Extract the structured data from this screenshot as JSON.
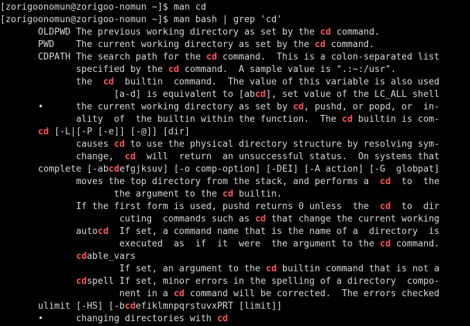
{
  "colors": {
    "background": "#000000",
    "foreground": "#d8d8d8",
    "match_highlight": "#ff5555"
  },
  "lines": [
    [
      {
        "t": "[zorigoonomun@zorigoo-nomun ~]$ man cd",
        "h": false
      }
    ],
    [
      {
        "t": "[zorigoonomun@zorigoo-nomun ~]$ man bash | grep 'cd'",
        "h": false
      }
    ],
    [
      {
        "t": "       OLDPWD The previous working directory as set by the ",
        "h": false
      },
      {
        "t": "cd",
        "h": true
      },
      {
        "t": " command.",
        "h": false
      }
    ],
    [
      {
        "t": "       PWD    The current working directory as set by the ",
        "h": false
      },
      {
        "t": "cd",
        "h": true
      },
      {
        "t": " command.",
        "h": false
      }
    ],
    [
      {
        "t": "       CDPATH The search path for the ",
        "h": false
      },
      {
        "t": "cd",
        "h": true
      },
      {
        "t": " command.  This is a colon-separated list",
        "h": false
      }
    ],
    [
      {
        "t": "              specified by the ",
        "h": false
      },
      {
        "t": "cd",
        "h": true
      },
      {
        "t": " command.  A sample value is \".:~:/usr\".",
        "h": false
      }
    ],
    [
      {
        "t": "              the  ",
        "h": false
      },
      {
        "t": "cd",
        "h": true
      },
      {
        "t": "  builtin  command.  The value of this variable is also used",
        "h": false
      }
    ],
    [
      {
        "t": "                     [a-d] is equivalent to [ab",
        "h": false
      },
      {
        "t": "cd",
        "h": true
      },
      {
        "t": "], set value of the LC_ALL shell",
        "h": false
      }
    ],
    [
      {
        "t": "       •      the current working directory as set by ",
        "h": false
      },
      {
        "t": "cd",
        "h": true
      },
      {
        "t": ", pushd, or popd, or  in-",
        "h": false
      }
    ],
    [
      {
        "t": "              ality  of  the builtin within the function.  The ",
        "h": false
      },
      {
        "t": "cd",
        "h": true
      },
      {
        "t": " builtin is com-",
        "h": false
      }
    ],
    [
      {
        "t": "       ",
        "h": false
      },
      {
        "t": "cd",
        "h": true
      },
      {
        "t": " [-L|[-P [-e]] [-@]] [dir]",
        "h": false
      }
    ],
    [
      {
        "t": "              causes ",
        "h": false
      },
      {
        "t": "cd",
        "h": true
      },
      {
        "t": " to use the physical directory structure by resolving sym-",
        "h": false
      }
    ],
    [
      {
        "t": "              change,  ",
        "h": false
      },
      {
        "t": "cd",
        "h": true
      },
      {
        "t": "  will  return  an unsuccessful status.  On systems that",
        "h": false
      }
    ],
    [
      {
        "t": "       complete [-ab",
        "h": false
      },
      {
        "t": "cd",
        "h": true
      },
      {
        "t": "efgjksuv] [-o comp-option] [-DEI] [-A action] [-G  globpat]",
        "h": false
      }
    ],
    [
      {
        "t": "              moves the top directory from the stack, and performs a  ",
        "h": false
      },
      {
        "t": "cd",
        "h": true
      },
      {
        "t": "  to  the",
        "h": false
      }
    ],
    [
      {
        "t": "                     the argument to the ",
        "h": false
      },
      {
        "t": "cd",
        "h": true
      },
      {
        "t": " builtin.",
        "h": false
      }
    ],
    [
      {
        "t": "              If the first form is used, pushd returns 0 unless  the  ",
        "h": false
      },
      {
        "t": "cd",
        "h": true
      },
      {
        "t": "  to  dir",
        "h": false
      }
    ],
    [
      {
        "t": "                      cuting  commands such as ",
        "h": false
      },
      {
        "t": "cd",
        "h": true
      },
      {
        "t": " that change the current working",
        "h": false
      }
    ],
    [
      {
        "t": "              auto",
        "h": false
      },
      {
        "t": "cd",
        "h": true
      },
      {
        "t": "  If set, a command name that is the name of a  directory  is",
        "h": false
      }
    ],
    [
      {
        "t": "                      executed  as  if  it  were  the argument to the ",
        "h": false
      },
      {
        "t": "cd",
        "h": true
      },
      {
        "t": " command.",
        "h": false
      }
    ],
    [
      {
        "t": "              ",
        "h": false
      },
      {
        "t": "cd",
        "h": true
      },
      {
        "t": "able_vars",
        "h": false
      }
    ],
    [
      {
        "t": "                      If set, an argument to the ",
        "h": false
      },
      {
        "t": "cd",
        "h": true
      },
      {
        "t": " builtin command that is not a",
        "h": false
      }
    ],
    [
      {
        "t": "              ",
        "h": false
      },
      {
        "t": "cd",
        "h": true
      },
      {
        "t": "spell If set, minor errors in the spelling of a directory  compo-",
        "h": false
      }
    ],
    [
      {
        "t": "                      nent in a ",
        "h": false
      },
      {
        "t": "cd",
        "h": true
      },
      {
        "t": " command will be corrected.  The errors checked",
        "h": false
      }
    ],
    [
      {
        "t": "       ulimit [-HS] [-b",
        "h": false
      },
      {
        "t": "cd",
        "h": true
      },
      {
        "t": "efiklmnpqrstuvxPRT [limit]]",
        "h": false
      }
    ],
    [
      {
        "t": "       •      changing directories with ",
        "h": false
      },
      {
        "t": "cd",
        "h": true
      }
    ]
  ]
}
